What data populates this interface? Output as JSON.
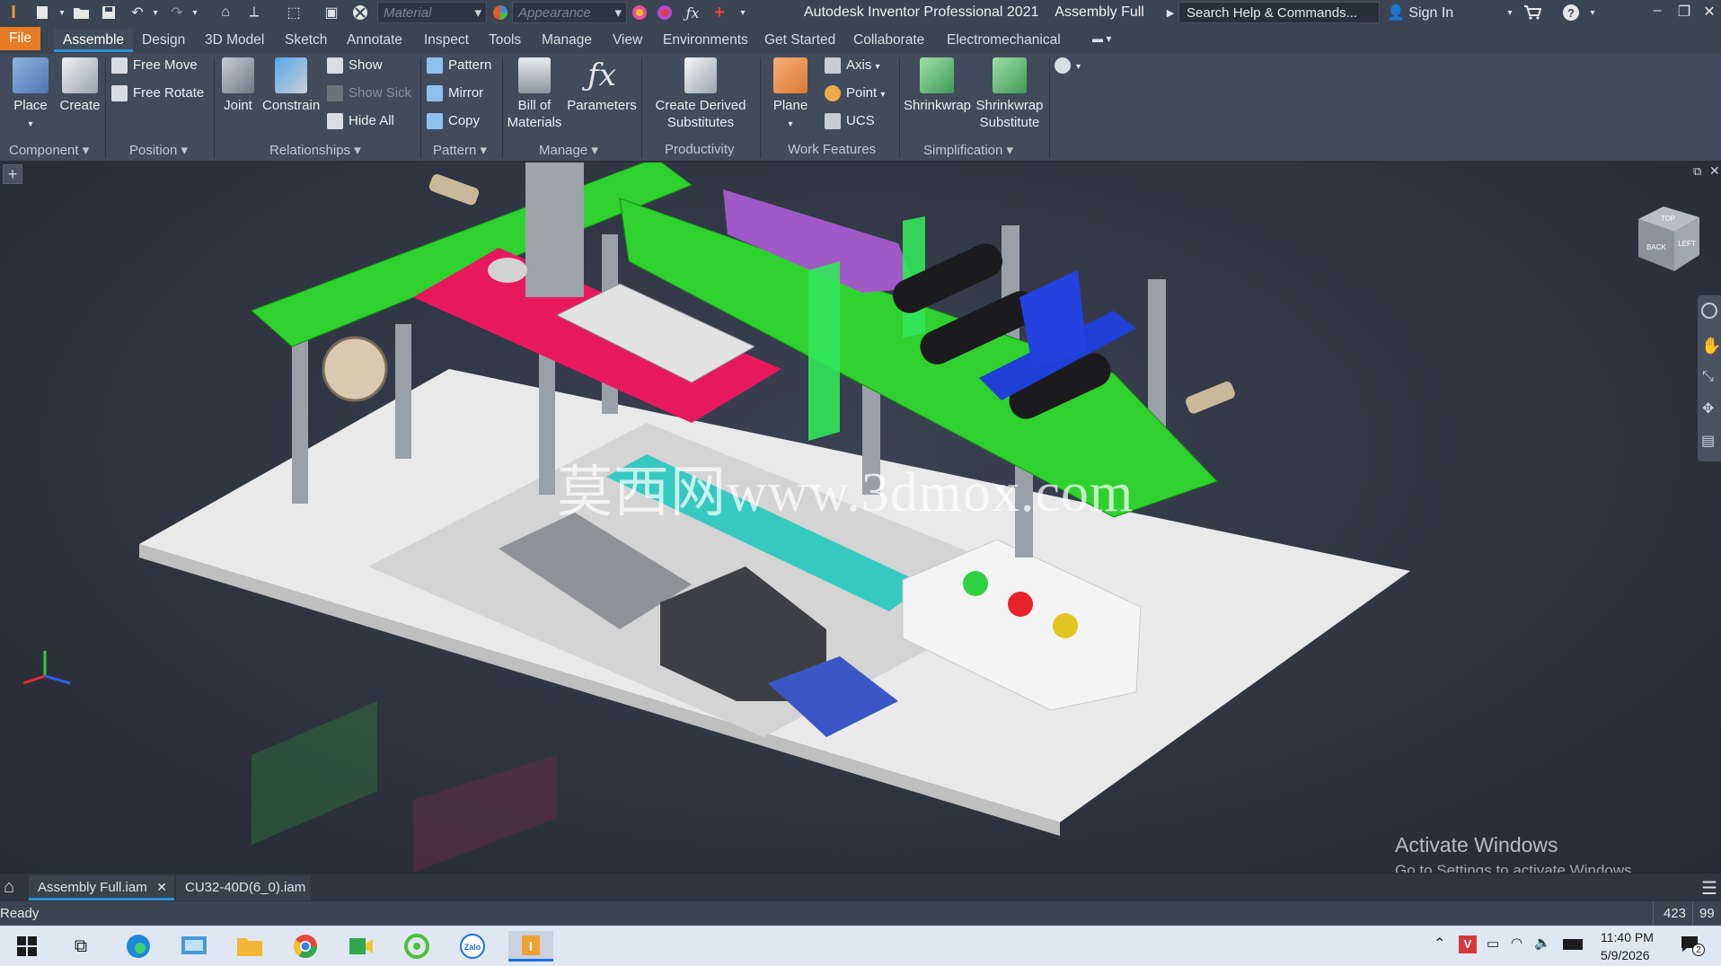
{
  "title_bar": {
    "app_title": "Autodesk Inventor Professional 2021",
    "document_name": "Assembly Full",
    "material_placeholder": "Material",
    "appearance_placeholder": "Appearance",
    "search_placeholder": "Search Help & Commands...",
    "sign_in": "Sign In"
  },
  "menu": {
    "tabs": [
      "File",
      "Assemble",
      "Design",
      "3D Model",
      "Sketch",
      "Annotate",
      "Inspect",
      "Tools",
      "Manage",
      "View",
      "Environments",
      "Get Started",
      "Collaborate",
      "Electromechanical"
    ],
    "active_tab": "Assemble"
  },
  "ribbon": {
    "component": {
      "label": "Component",
      "place": "Place",
      "create": "Create"
    },
    "position": {
      "label": "Position",
      "free_move": "Free Move",
      "free_rotate": "Free Rotate"
    },
    "relationships": {
      "label": "Relationships",
      "joint": "Joint",
      "constrain": "Constrain",
      "show": "Show",
      "show_sick": "Show Sick",
      "hide_all": "Hide All"
    },
    "pattern": {
      "label": "Pattern",
      "pattern": "Pattern",
      "mirror": "Mirror",
      "copy": "Copy"
    },
    "manage": {
      "label": "Manage",
      "bom_line1": "Bill of",
      "bom_line2": "Materials",
      "parameters": "Parameters"
    },
    "productivity": {
      "label": "Productivity",
      "line1": "Create Derived",
      "line2": "Substitutes"
    },
    "work_features": {
      "label": "Work Features",
      "plane": "Plane",
      "axis": "Axis",
      "point": "Point",
      "ucs": "UCS"
    },
    "simplification": {
      "label": "Simplification",
      "shrinkwrap": "Shrinkwrap",
      "sub_line1": "Shrinkwrap",
      "sub_line2": "Substitute"
    }
  },
  "viewport": {
    "watermark": "莫西网www.3dmox.com",
    "activate_title": "Activate Windows",
    "activate_sub": "Go to Settings to activate Windows.",
    "view_cube_faces": [
      "TOP",
      "BACK",
      "LEFT"
    ],
    "colors": {
      "conveyor": "#2fd12f",
      "plate": "#e8185f",
      "frame": "#9aa0a8",
      "base": "#e9e9e9",
      "terminal": "#36c9c0",
      "blue_part": "#1f3fd6",
      "purple_part": "#a05ac8"
    }
  },
  "document_tabs": [
    {
      "label": "Assembly Full.iam",
      "active": true
    },
    {
      "label": "CU32-40D(6_0).iam",
      "active": false
    }
  ],
  "status": {
    "text": "Ready",
    "count1": "423",
    "count2": "99"
  },
  "taskbar": {
    "time": "11:40 PM",
    "date": "5/9/2026",
    "notifications": "2"
  }
}
